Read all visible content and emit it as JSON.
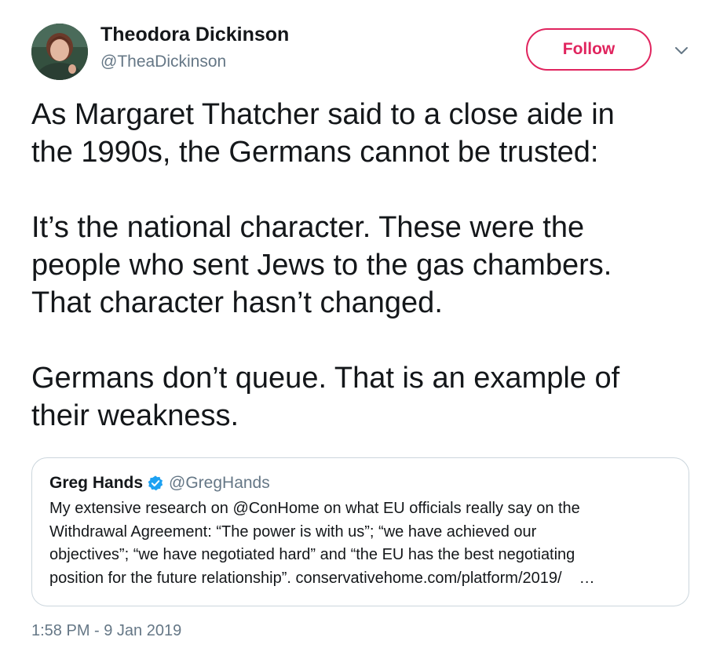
{
  "author": {
    "name": "Theodora Dickinson",
    "handle": "@TheaDickinson",
    "avatar_icon": "profile-photo"
  },
  "follow_button": {
    "label": "Follow",
    "color": "#e0245e"
  },
  "menu_icon": "chevron-down-icon",
  "tweet": {
    "paragraphs": [
      [
        "As Margaret Thatcher said to a close aide in",
        "the 1990s, the Germans cannot be trusted:"
      ],
      [
        "It’s the national character. These were the",
        "people who sent Jews to the gas chambers.",
        "That character hasn’t changed."
      ],
      [
        "Germans don’t queue. That is an example of",
        "their weakness."
      ]
    ]
  },
  "quoted_tweet": {
    "name": "Greg Hands",
    "verified_icon": "verified-badge-icon",
    "handle": "@GregHands",
    "lines": [
      "My extensive research on @ConHome on what EU officials really say on the",
      "Withdrawal Agreement: “The power is with us”; “we have achieved our",
      "objectives”; “we have negotiated hard” and “the EU has the best negotiating"
    ],
    "last_line_text": "position for the future relationship”. ",
    "link": "conservativehome.com/platform/2019/",
    "ellipsis": "…"
  },
  "timestamp": "1:58 PM - 9 Jan 2019",
  "colors": {
    "text": "#14171a",
    "secondary": "#657786",
    "border": "#ccd6dd",
    "verified": "#1da1f2"
  }
}
